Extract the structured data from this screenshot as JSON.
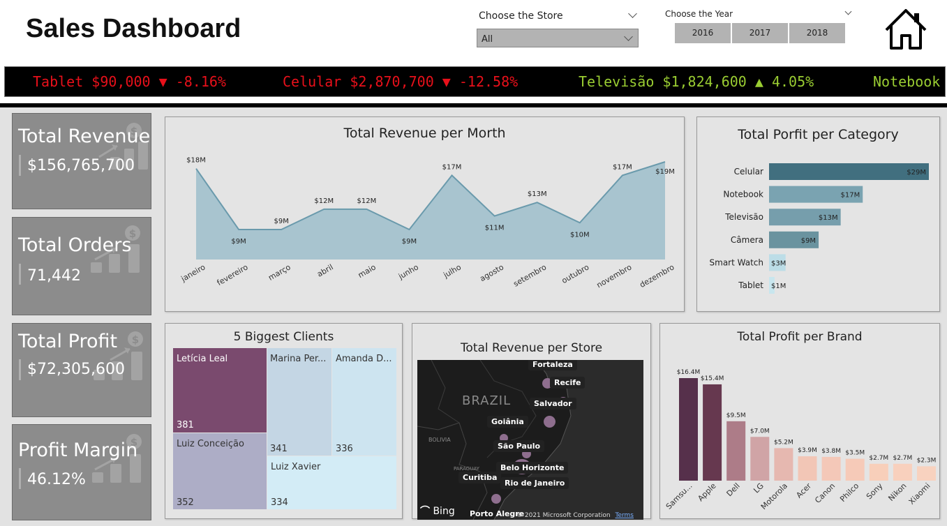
{
  "header": {
    "title": "Sales Dashboard",
    "store_label": "Choose the Store",
    "store_value": "All",
    "year_label": "Choose the Year",
    "years": [
      "2016",
      "2017",
      "2018"
    ]
  },
  "ticker": [
    {
      "text": "Tablet $90,000 ▼ -8.16%",
      "color": "#e8101a"
    },
    {
      "text": "Celular $2,870,700 ▼ -12.58%",
      "color": "#e8101a"
    },
    {
      "text": "Televisão $1,824,600 ▲ 4.05%",
      "color": "#9acd32"
    },
    {
      "text": "Notebook",
      "color": "#9acd32"
    }
  ],
  "kpis": [
    {
      "title": "Total Revenue",
      "value": "$156,765,700"
    },
    {
      "title": "Total Orders",
      "value": "71,442"
    },
    {
      "title": "Total Profit",
      "value": "$72,305,600"
    },
    {
      "title": "Profit Margin",
      "value": "46.12%"
    }
  ],
  "revenue_month": {
    "title": "Total Revenue per Morth"
  },
  "profit_category": {
    "title": "Total Porfit per Category"
  },
  "clients": {
    "title": "5 Biggest Clients",
    "items": [
      {
        "name": "Letícia Leal",
        "value": "381",
        "color": "#7a4a6e"
      },
      {
        "name": "Marina Per...",
        "value": "341",
        "color": "#c4d6e4"
      },
      {
        "name": "Amanda D...",
        "value": "336",
        "color": "#cde4f0"
      },
      {
        "name": "Luiz Conceição",
        "value": "352",
        "color": "#adadc6"
      },
      {
        "name": "Luiz Xavier",
        "value": "334",
        "color": "#d3ecf6"
      }
    ]
  },
  "map": {
    "title": "Total Revenue per Store",
    "country": "BRAZIL",
    "labels": {
      "bolivia": "BOLIVIA",
      "paraguay": "PARAGUAY"
    },
    "cities": [
      "Fortaleza",
      "Recife",
      "Salvador",
      "Goiânia",
      "São Paulo",
      "Belo Horizonte",
      "Curitiba",
      "Rio de Janeiro",
      "Porto Alegre"
    ],
    "bing": "Bing",
    "copyright": "© 2021 Microsoft Corporation",
    "terms": "Terms"
  },
  "profit_brand": {
    "title": "Total Profit per Brand"
  },
  "chart_data": [
    {
      "type": "area",
      "title": "Total Revenue per Morth",
      "categories": [
        "janeiro",
        "fevereiro",
        "março",
        "abril",
        "maio",
        "junho",
        "julho",
        "agosto",
        "setembro",
        "outubro",
        "novembro",
        "dezembro"
      ],
      "values": [
        18,
        9,
        9,
        12,
        12,
        9,
        17,
        11,
        13,
        10,
        17,
        19
      ],
      "labels": [
        "$18M",
        "$9M",
        "$9M",
        "$12M",
        "$12M",
        "$9M",
        "$17M",
        "$11M",
        "$13M",
        "$10M",
        "$17M",
        "$19M"
      ],
      "color": "#a8c4cf",
      "line_color": "#6a9aac"
    },
    {
      "type": "bar",
      "orientation": "horizontal",
      "title": "Total Porfit per Category",
      "categories": [
        "Celular",
        "Notebook",
        "Televisão",
        "Câmera",
        "Smart Watch",
        "Tablet"
      ],
      "values": [
        29,
        17,
        13,
        9,
        3,
        1
      ],
      "labels": [
        "$29M",
        "$17M",
        "$13M",
        "$9M",
        "$3M",
        "$1M"
      ],
      "colors": [
        "#416f7f",
        "#7aa3b1",
        "#769eac",
        "#6a939f",
        "#bcdde7",
        "#c8e6ee"
      ]
    },
    {
      "type": "bar",
      "title": "Total Profit per Brand",
      "categories": [
        "Samsu...",
        "Apple",
        "Dell",
        "LG",
        "Motorola",
        "Acer",
        "Canon",
        "Philco",
        "Sony",
        "Nikon",
        "Xiaomi"
      ],
      "values": [
        16.4,
        15.4,
        9.5,
        7.0,
        5.2,
        3.9,
        3.8,
        3.5,
        2.7,
        2.7,
        2.3
      ],
      "labels": [
        "$16.4M",
        "$15.4M",
        "$9.5M",
        "$7.0M",
        "$5.2M",
        "$3.9M",
        "$3.8M",
        "$3.5M",
        "$2.7M",
        "$2.7M",
        "$2.3M"
      ],
      "colors": [
        "#56304b",
        "#66384f",
        "#ad7c88",
        "#d0a4a6",
        "#e6b8b0",
        "#f2c6b6",
        "#f4c8b8",
        "#f6cab8",
        "#f8cfba",
        "#f8d0bd",
        "#f8d2bf"
      ]
    }
  ]
}
